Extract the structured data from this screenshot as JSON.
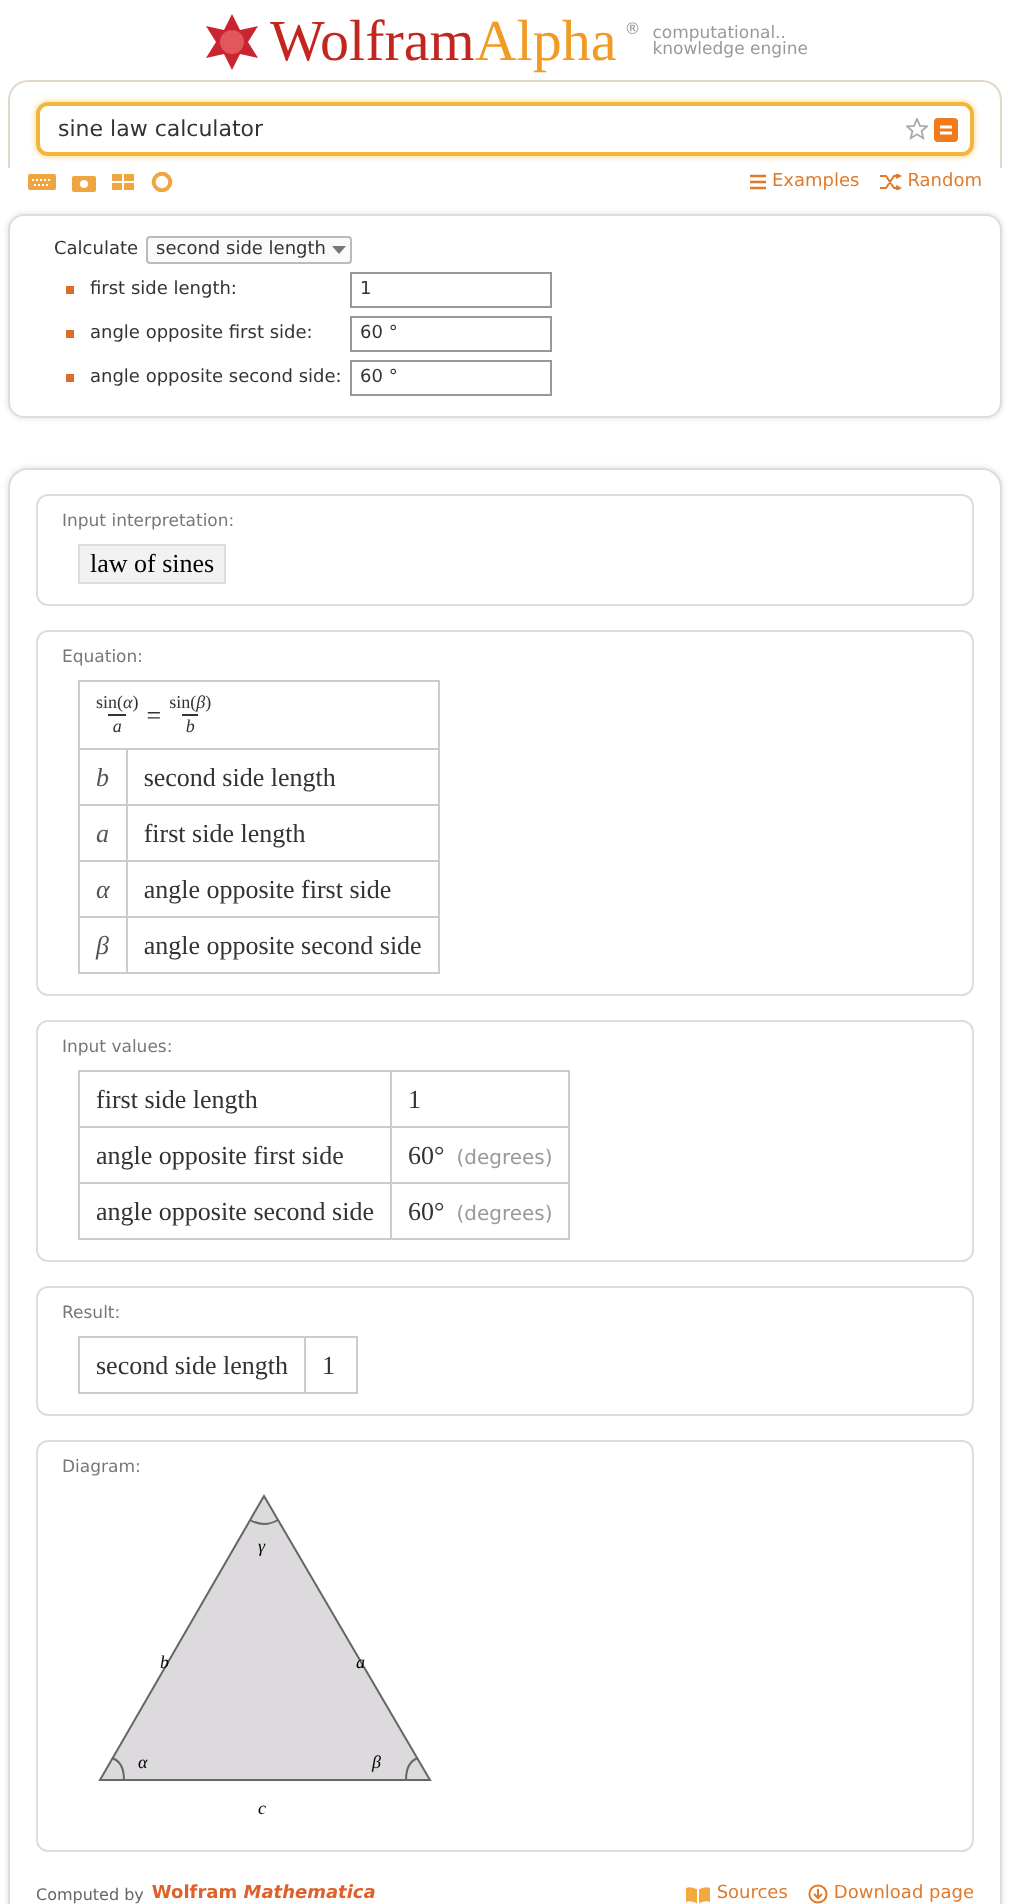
{
  "header": {
    "logo_left": "Wolfram",
    "logo_right": "Alpha",
    "registered": "®",
    "tagline": [
      "computational..",
      "knowledge engine"
    ],
    "search": {
      "value": "sine law calculator"
    },
    "links": [
      {
        "kind": "list",
        "label": "Examples"
      },
      {
        "kind": "shuffle",
        "label": "Random"
      }
    ]
  },
  "form": {
    "calculate_label": "Calculate",
    "calculate_value": "second side length",
    "fields": [
      {
        "label": "first side length:",
        "value": "1"
      },
      {
        "label": "angle opposite first side:",
        "value": "60 °"
      },
      {
        "label": "angle opposite second side:",
        "value": "60 °"
      }
    ]
  },
  "pods": [
    {
      "kind": "interpretation",
      "title": "Input interpretation:",
      "text": "law of sines"
    },
    {
      "kind": "equation",
      "title": "Equation:",
      "equation": {
        "left_num": "sin(*α*)",
        "left_den": "*a*",
        "sign": "=",
        "right_num": "sin(*β*)",
        "right_den": "*b*"
      },
      "rows": [
        {
          "symbol": "b",
          "meaning": "second side length"
        },
        {
          "symbol": "a",
          "meaning": "first side length"
        },
        {
          "symbol": "α",
          "meaning": "angle opposite first side"
        },
        {
          "symbol": "β",
          "meaning": "angle opposite second side"
        }
      ]
    },
    {
      "kind": "values",
      "title": "Input values:",
      "rows": [
        {
          "name": "first side length",
          "value": "1"
        },
        {
          "name": "angle opposite first side",
          "value": "60°",
          "unit": "(degrees)"
        },
        {
          "name": "angle opposite second side",
          "value": "60°",
          "unit": "(degrees)"
        }
      ]
    },
    {
      "kind": "result",
      "title": "Result:",
      "rows": [
        {
          "name": "second side length",
          "value": "1"
        }
      ]
    },
    {
      "kind": "diagram",
      "title": "Diagram:",
      "labels": {
        "top": "γ",
        "left_side": "b",
        "right_side": "a",
        "left_angle": "α",
        "right_angle": "β",
        "base": "c"
      }
    }
  ],
  "footer": {
    "computed_by": "Computed by",
    "brand": "Wolfram *Mathematica*",
    "links": [
      {
        "kind": "book",
        "label": "Sources"
      },
      {
        "kind": "download",
        "label": "Download page"
      }
    ]
  }
}
